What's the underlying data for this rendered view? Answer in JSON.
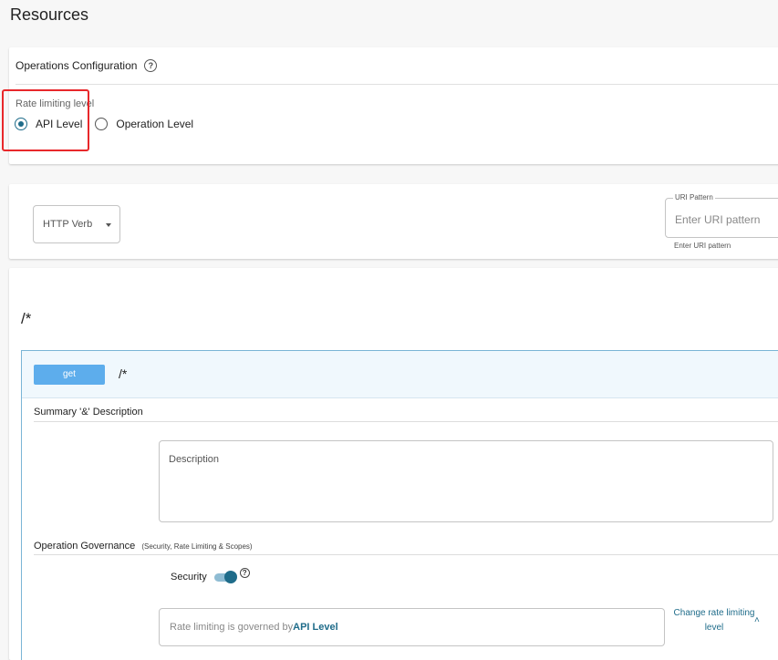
{
  "page": {
    "title": "Resources"
  },
  "operations_config": {
    "title": "Operations Configuration",
    "help_icon": "?",
    "rate_limit_label": "Rate limiting level",
    "options": [
      {
        "label": "API Level",
        "selected": true
      },
      {
        "label": "Operation Level",
        "selected": false
      }
    ]
  },
  "add_resource": {
    "http_verb_label": "HTTP Verb",
    "uri_pattern_legend": "URI Pattern",
    "uri_pattern_placeholder": "Enter URI pattern",
    "uri_pattern_helper": "Enter URI pattern"
  },
  "resource": {
    "path": "/*",
    "operation": {
      "method": "get",
      "path": "/*",
      "summary_title": "Summary '&' Description",
      "description_placeholder": "Description",
      "governance_title": "Operation Governance",
      "governance_subtitle": "(Security, Rate Limiting & Scopes)",
      "security_label": "Security",
      "security_enabled": true,
      "rate_limit_text": "Rate limiting is governed by",
      "rate_limit_link": "API Level",
      "change_rate_limit_label": "Change rate limiting level"
    }
  },
  "colors": {
    "accent": "#1f6c8a",
    "get_button": "#5dadec",
    "highlight": "#e8282b"
  }
}
